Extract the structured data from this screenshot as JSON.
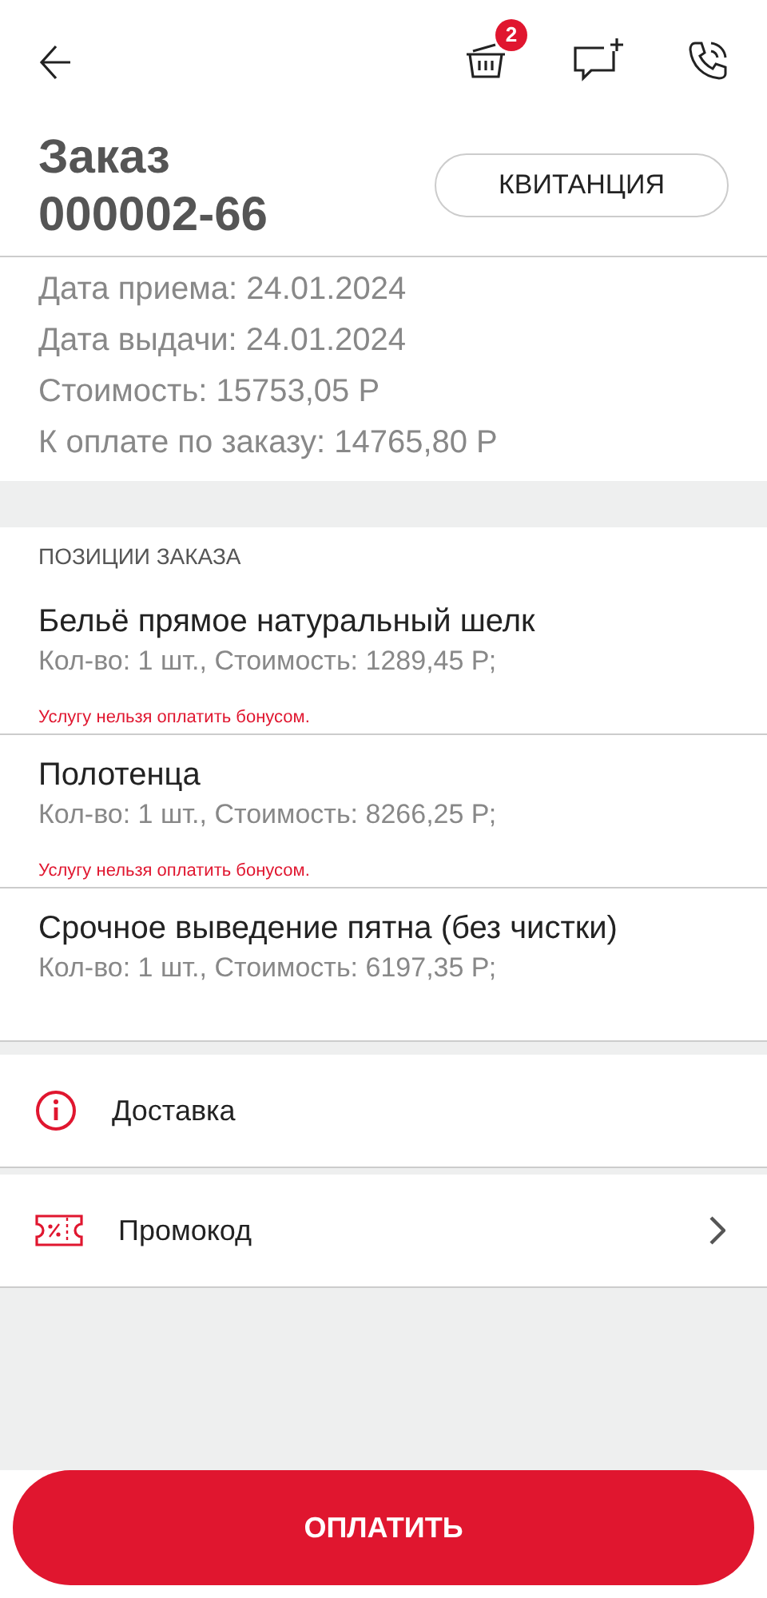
{
  "header": {
    "cart_count": "2"
  },
  "order": {
    "title": "Заказ",
    "number": "000002-66",
    "receipt_button": "КВИТАНЦИЯ",
    "details": [
      "Дата приема: 24.01.2024",
      "Дата выдачи: 24.01.2024",
      "Стоимость: 15753,05 Р",
      "К оплате по заказу: 14765,80 Р"
    ]
  },
  "positions": {
    "heading": "ПОЗИЦИИ ЗАКАЗА",
    "items": [
      {
        "name": "Бельё прямое натуральный шелк",
        "info": "Кол-во: 1 шт., Стоимость: 1289,45 Р;",
        "warning": "Услугу нельзя оплатить бонусом."
      },
      {
        "name": "Полотенца",
        "info": "Кол-во: 1 шт., Стоимость: 8266,25 Р;",
        "warning": "Услугу нельзя оплатить бонусом."
      },
      {
        "name": "Срочное выведение пятна (без чистки)",
        "info": "Кол-во: 1 шт., Стоимость: 6197,35 Р;"
      }
    ]
  },
  "options": [
    {
      "kind": "info",
      "label": "Доставка"
    },
    {
      "kind": "promo",
      "label": "Промокод"
    }
  ],
  "pay_button": "ОПЛАТИТЬ"
}
